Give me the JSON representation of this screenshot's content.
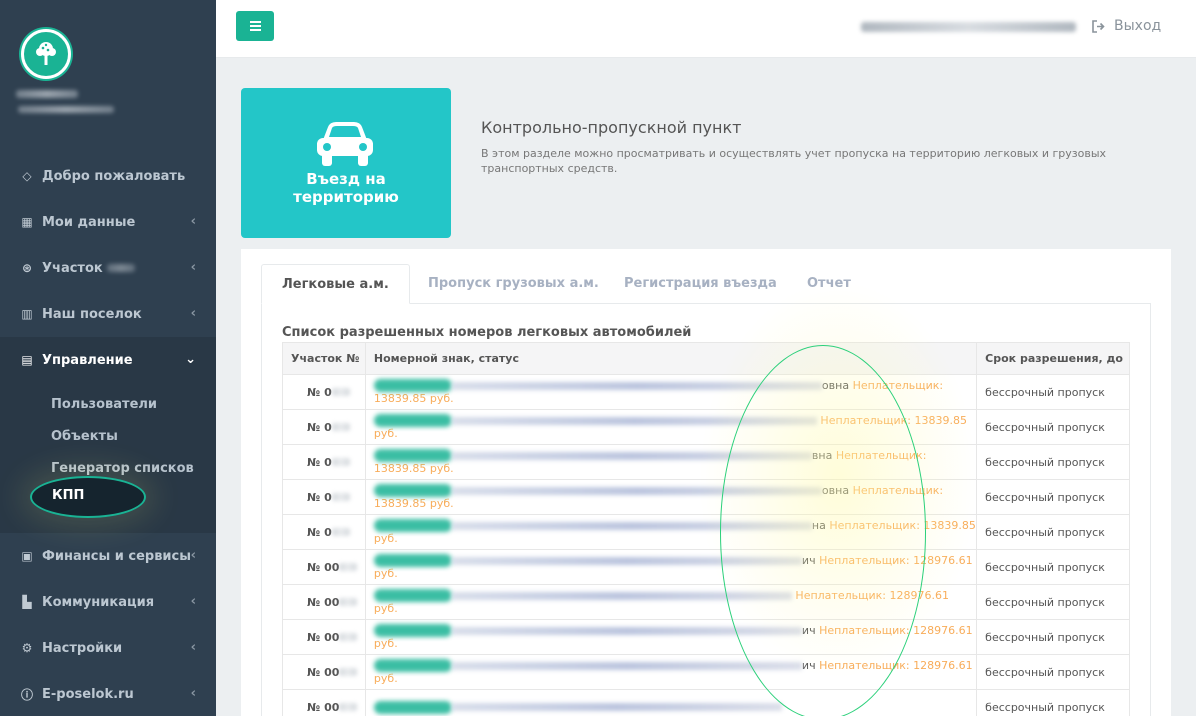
{
  "sidebar": {
    "items": [
      {
        "label": "Добро пожаловать",
        "icon": "diamond-icon"
      },
      {
        "label": "Мои данные",
        "icon": "grid-icon"
      },
      {
        "label": "Участок",
        "icon": "gear-wheel-icon"
      },
      {
        "label": "Наш поселок",
        "icon": "bar-chart-icon"
      },
      {
        "label": "Управление",
        "icon": "table-icon"
      },
      {
        "label": "Финансы и сервисы",
        "icon": "money-icon"
      },
      {
        "label": "Коммуникация",
        "icon": "address-book-icon"
      },
      {
        "label": "Настройки",
        "icon": "cogs-icon"
      },
      {
        "label": "E-poselok.ru",
        "icon": "info-icon"
      }
    ],
    "submenu": [
      "Пользователи",
      "Объекты",
      "Генератор списков",
      "КПП"
    ]
  },
  "topbar": {
    "logout_label": "Выход"
  },
  "hero": {
    "line1": "Въезд на",
    "line2": "территорию"
  },
  "section": {
    "title": "Контрольно-пропускной пункт",
    "description": "В этом разделе можно просматривать и осуществлять учет пропуска на территорию легковых и грузовых транспортных средств."
  },
  "tabs": [
    "Легковые а.м.",
    "Пропуск грузовых а.м.",
    "Регистрация въезда",
    "Отчет"
  ],
  "list": {
    "title": "Список разрешенных номеров легковых автомобилей",
    "columns": [
      "Участок №",
      "Номерной знак, статус",
      "Срок разрешения, до"
    ],
    "rows": [
      {
        "plot": "№ 0",
        "suffix": "овна",
        "status": "Неплательщик: 13839.85 руб.",
        "term": "бессрочный пропуск"
      },
      {
        "plot": "№ 0",
        "suffix": "",
        "status": "Неплательщик: 13839.85 руб.",
        "term": "бессрочный пропуск"
      },
      {
        "plot": "№ 0",
        "suffix": "вна",
        "status": "Неплательщик: 13839.85 руб.",
        "term": "бессрочный пропуск"
      },
      {
        "plot": "№ 0",
        "suffix": "овна",
        "status": "Неплательщик: 13839.85 руб.",
        "term": "бессрочный пропуск"
      },
      {
        "plot": "№ 0",
        "suffix": "на",
        "status": "Неплательщик: 13839.85 руб.",
        "term": "бессрочный пропуск"
      },
      {
        "plot": "№ 00",
        "suffix": "ич",
        "status": "Неплательщик: 128976.61 руб.",
        "term": "бессрочный пропуск"
      },
      {
        "plot": "№ 00",
        "suffix": "",
        "status": "Неплательщик: 128976.61 руб.",
        "term": "бессрочный пропуск"
      },
      {
        "plot": "№ 00",
        "suffix": "ич",
        "status": "Неплательщик: 128976.61 руб.",
        "term": "бессрочный пропуск"
      },
      {
        "plot": "№ 00",
        "suffix": "ич",
        "status": "Неплательщик: 128976.61 руб.",
        "term": "бессрочный пропуск"
      },
      {
        "plot": "№ 00",
        "suffix": "",
        "status": "",
        "term": "бессрочный пропуск"
      }
    ]
  },
  "colors": {
    "accent": "#1ab394",
    "sidebar": "#2f4050",
    "hero": "#23c6c8",
    "warning": "#f8ac59"
  }
}
